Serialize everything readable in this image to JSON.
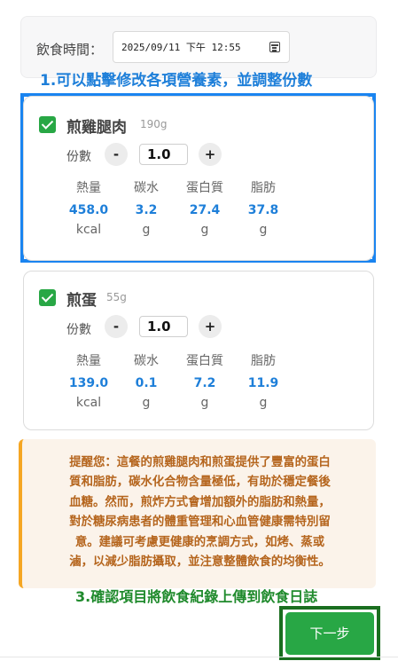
{
  "meal_time": {
    "label": "飲食時間：",
    "value": "2025/09/11 下午 12:55",
    "icon": "calendar-icon"
  },
  "annotations": {
    "step1": "1.可以點擊修改各項營養素，並調整份數",
    "step3": "3.確認項目將飲食紀錄上傳到飲食日誌"
  },
  "colors": {
    "accent_blue": "#1e7fd9",
    "checkbox_green": "#28a745",
    "highlight_blue": "#1a84f0",
    "tip_text": "#b5651d",
    "tip_border": "#f5a623"
  },
  "serving_label": "份數",
  "minus_label": "-",
  "plus_label": "+",
  "nutrient_labels": [
    "熱量",
    "碳水",
    "蛋白質",
    "脂肪"
  ],
  "foods": [
    {
      "name": "煎雞腿肉",
      "weight": "190g",
      "checked": true,
      "servings": "1.0",
      "nutrients": [
        {
          "value": "458.0",
          "unit": "kcal"
        },
        {
          "value": "3.2",
          "unit": "g"
        },
        {
          "value": "27.4",
          "unit": "g"
        },
        {
          "value": "37.8",
          "unit": "g"
        }
      ]
    },
    {
      "name": "煎蛋",
      "weight": "55g",
      "checked": true,
      "servings": "1.0",
      "nutrients": [
        {
          "value": "139.0",
          "unit": "kcal"
        },
        {
          "value": "0.1",
          "unit": "g"
        },
        {
          "value": "7.2",
          "unit": "g"
        },
        {
          "value": "11.9",
          "unit": "g"
        }
      ]
    }
  ],
  "tip": {
    "lines": [
      "提醒您：這餐的煎雞腿肉和煎蛋提供了豐富的蛋白",
      "質和脂肪，碳水化合物含量極低，有助於穩定餐後",
      "血糖。然而，煎炸方式會增加額外的脂肪和熱量，",
      "對於糖尿病患者的體重管理和心血管健康需特別留",
      "意。建議可考慮更健康的烹調方式，如烤、蒸或",
      "滷，以減少脂肪攝取，並注意整體飲食的均衡性。"
    ]
  },
  "next_button_label": "下一步"
}
